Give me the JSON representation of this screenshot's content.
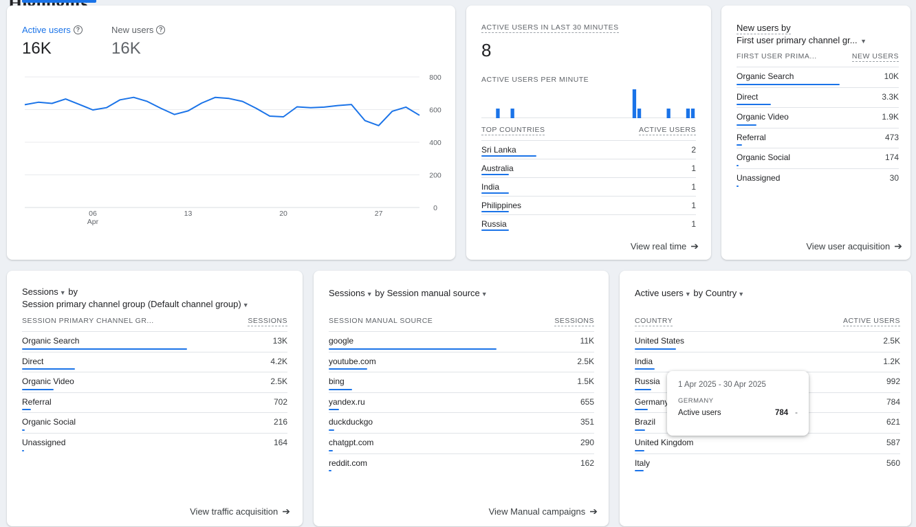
{
  "header": {
    "tab_fragment": "Highlights"
  },
  "overview": {
    "active_label": "Active users",
    "active_value": "16K",
    "new_label": "New users",
    "new_value": "16K",
    "chart_data": {
      "type": "line",
      "x": [
        "01 Apr",
        "02 Apr",
        "03 Apr",
        "04 Apr",
        "05 Apr",
        "06 Apr",
        "07 Apr",
        "08 Apr",
        "09 Apr",
        "10 Apr",
        "11 Apr",
        "12 Apr",
        "13 Apr",
        "14 Apr",
        "15 Apr",
        "16 Apr",
        "17 Apr",
        "18 Apr",
        "19 Apr",
        "20 Apr",
        "21 Apr",
        "22 Apr",
        "23 Apr",
        "24 Apr",
        "25 Apr",
        "26 Apr",
        "27 Apr",
        "28 Apr",
        "29 Apr",
        "30 Apr"
      ],
      "series": [
        {
          "name": "Active users",
          "values": [
            630,
            645,
            638,
            665,
            632,
            598,
            612,
            660,
            675,
            650,
            608,
            570,
            592,
            640,
            675,
            668,
            650,
            608,
            560,
            556,
            617,
            612,
            615,
            625,
            631,
            532,
            502,
            590,
            615,
            565
          ]
        }
      ],
      "yticks": [
        0,
        200,
        400,
        600,
        800
      ],
      "ylim": [
        0,
        800
      ],
      "xtick_labels": [
        {
          "day": "06",
          "month": "Apr"
        },
        {
          "day": "13",
          "month": ""
        },
        {
          "day": "20",
          "month": ""
        },
        {
          "day": "27",
          "month": ""
        }
      ],
      "xtick_index": [
        5,
        12,
        19,
        26
      ],
      "line_color": "#1a73e8",
      "grid": true
    }
  },
  "realtime": {
    "title": "ACTIVE USERS IN LAST 30 MINUTES",
    "count": "8",
    "per_minute_label": "ACTIVE USERS PER MINUTE",
    "chart_data": {
      "type": "bar",
      "values": [
        0,
        0,
        0,
        1,
        0,
        0,
        1,
        0,
        0,
        0,
        0,
        0,
        0,
        0,
        0,
        0,
        0,
        0,
        0,
        0,
        0,
        0,
        0,
        0,
        0,
        0,
        0,
        0,
        0,
        0,
        0,
        3,
        1,
        0,
        0,
        0,
        0,
        0,
        1,
        0,
        0,
        0,
        1,
        1
      ],
      "color": "#1a73e8"
    },
    "table_header": {
      "country": "TOP COUNTRIES",
      "metric": "ACTIVE USERS"
    },
    "rows": [
      {
        "name": "Sri Lanka",
        "value": "2",
        "share": 1.0
      },
      {
        "name": "Australia",
        "value": "1",
        "share": 0.5
      },
      {
        "name": "India",
        "value": "1",
        "share": 0.5
      },
      {
        "name": "Philippines",
        "value": "1",
        "share": 0.5
      },
      {
        "name": "Russia",
        "value": "1",
        "share": 0.5
      }
    ],
    "link": "View real time"
  },
  "new_users": {
    "title_line1": "New users by",
    "title_line2": "First user primary channel gr...",
    "table_header": {
      "dim": "FIRST USER PRIMA...",
      "metric": "NEW USERS"
    },
    "rows": [
      {
        "name": "Organic Search",
        "value": "10K",
        "share": 1.0
      },
      {
        "name": "Direct",
        "value": "3.3K",
        "share": 0.33
      },
      {
        "name": "Organic Video",
        "value": "1.9K",
        "share": 0.19
      },
      {
        "name": "Referral",
        "value": "473",
        "share": 0.05
      },
      {
        "name": "Organic Social",
        "value": "174",
        "share": 0.02
      },
      {
        "name": "Unassigned",
        "value": "30",
        "share": 0.005
      }
    ],
    "link": "View user acquisition"
  },
  "sessions_channel": {
    "metric_label": "Sessions",
    "by": "by",
    "dimension_label": "Session primary channel group (Default channel group)",
    "table_header": {
      "dim": "SESSION PRIMARY CHANNEL GR...",
      "metric": "SESSIONS"
    },
    "rows": [
      {
        "name": "Organic Search",
        "value": "13K",
        "share": 1.0
      },
      {
        "name": "Direct",
        "value": "4.2K",
        "share": 0.32
      },
      {
        "name": "Organic Video",
        "value": "2.5K",
        "share": 0.19
      },
      {
        "name": "Referral",
        "value": "702",
        "share": 0.054
      },
      {
        "name": "Organic Social",
        "value": "216",
        "share": 0.017
      },
      {
        "name": "Unassigned",
        "value": "164",
        "share": 0.013
      }
    ],
    "link": "View traffic acquisition"
  },
  "sessions_source": {
    "metric_label": "Sessions",
    "dimension_text": "by Session manual source",
    "table_header": {
      "dim": "SESSION MANUAL SOURCE",
      "metric": "SESSIONS"
    },
    "rows": [
      {
        "name": "google",
        "value": "11K",
        "share": 1.0
      },
      {
        "name": "youtube.com",
        "value": "2.5K",
        "share": 0.23
      },
      {
        "name": "bing",
        "value": "1.5K",
        "share": 0.14
      },
      {
        "name": "yandex.ru",
        "value": "655",
        "share": 0.06
      },
      {
        "name": "duckduckgo",
        "value": "351",
        "share": 0.032
      },
      {
        "name": "chatgpt.com",
        "value": "290",
        "share": 0.026
      },
      {
        "name": "reddit.com",
        "value": "162",
        "share": 0.015
      }
    ],
    "link": "View Manual campaigns"
  },
  "country": {
    "metric_label": "Active users",
    "dimension_text": "by Country",
    "table_header": {
      "dim": "COUNTRY",
      "metric": "ACTIVE USERS"
    },
    "rows": [
      {
        "name": "United States",
        "value": "2.5K",
        "share": 1.0
      },
      {
        "name": "India",
        "value": "1.2K",
        "share": 0.48
      },
      {
        "name": "Russia",
        "value": "992",
        "share": 0.4
      },
      {
        "name": "Germany",
        "value": "784",
        "share": 0.31
      },
      {
        "name": "Brazil",
        "value": "621",
        "share": 0.25
      },
      {
        "name": "United Kingdom",
        "value": "587",
        "share": 0.23
      },
      {
        "name": "Italy",
        "value": "560",
        "share": 0.22
      }
    ],
    "tooltip": {
      "date": "1 Apr 2025 - 30 Apr 2025",
      "country": "GERMANY",
      "metric": "Active users",
      "value": "784",
      "trail": "-"
    }
  }
}
